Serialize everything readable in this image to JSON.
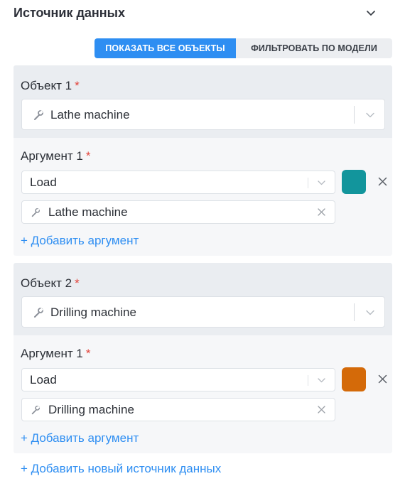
{
  "header": {
    "title": "Источник данных"
  },
  "mode_switch": {
    "show_all_label": "ПОКАЗАТЬ ВСЕ ОБЪЕКТЫ",
    "filter_label": "ФИЛЬТРОВАТЬ ПО МОДЕЛИ",
    "active": "show_all"
  },
  "required_mark": "*",
  "objects": [
    {
      "label": "Объект 1",
      "selected": "Lathe machine",
      "argument": {
        "label": "Аргумент 1",
        "selected": "Load",
        "color": "#12959c",
        "object_value": "Lathe machine"
      },
      "add_argument_label": "+ Добавить аргумент"
    },
    {
      "label": "Объект 2",
      "selected": "Drilling machine",
      "argument": {
        "label": "Аргумент 1",
        "selected": "Load",
        "color": "#d46a09",
        "object_value": "Drilling machine"
      },
      "add_argument_label": "+ Добавить аргумент"
    }
  ],
  "add_source_label": "+ Добавить новый источник данных",
  "colors": {
    "accent": "#2e8ef2",
    "required": "#e2453c",
    "panel_top": "#eaedf1",
    "panel_bottom": "#f6f7f9"
  }
}
